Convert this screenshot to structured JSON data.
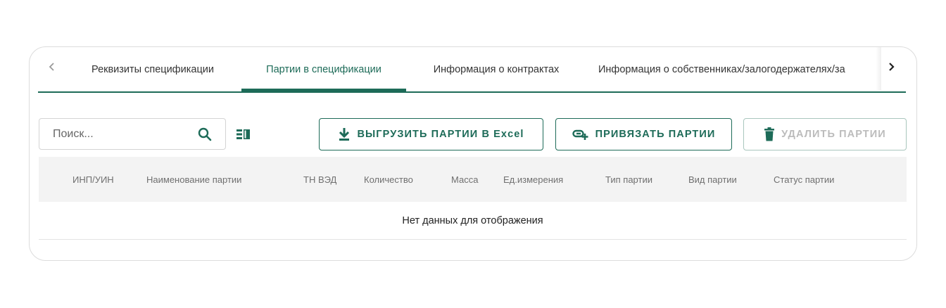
{
  "tabs": {
    "items": [
      {
        "label": "Реквизиты спецификации"
      },
      {
        "label": "Партии в спецификации",
        "active": true
      },
      {
        "label": "Информация о контрактах"
      },
      {
        "label": "Информация о собственниках/залогодержателях/за"
      }
    ],
    "prev_icon": "chevron-left-icon",
    "next_icon": "chevron-right-icon"
  },
  "toolbar": {
    "search_placeholder": "Поиск...",
    "search_value": "",
    "search_icon": "search-icon",
    "columns_icon": "columns-icon",
    "export_label": "ВЫГРУЗИТЬ ПАРТИИ В Excel",
    "bind_label": "ПРИВЯЗАТЬ ПАРТИИ",
    "delete_label": "УДАЛИТЬ ПАРТИИ",
    "delete_disabled": true
  },
  "table": {
    "columns": [
      "ИНП/УИН",
      "Наименование партии",
      "ТН ВЭД",
      "Количество",
      "Масса",
      "Ед.измерения",
      "Тип партии",
      "Вид партии",
      "Статус партии"
    ],
    "empty_text": "Нет данных для отображения"
  },
  "colors": {
    "accent": "#1d6b58",
    "disabled_border": "#a9c6bd",
    "disabled_text": "#bcbcbc",
    "header_bg": "#f3f3f3"
  }
}
